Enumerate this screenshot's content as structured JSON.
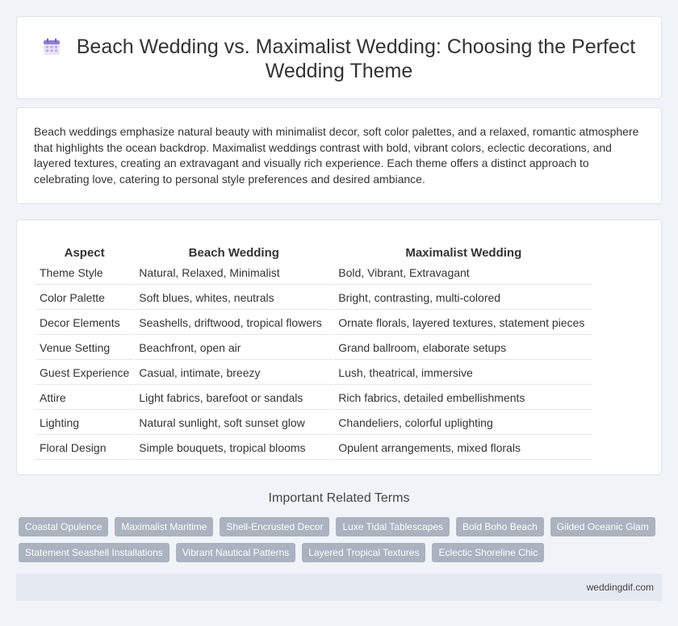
{
  "header": {
    "title": "Beach Wedding vs. Maximalist Wedding: Choosing the Perfect Wedding Theme",
    "icon": "calendar-icon"
  },
  "intro": {
    "text": "Beach weddings emphasize natural beauty with minimalist decor, soft color palettes, and a relaxed, romantic atmosphere that highlights the ocean backdrop. Maximalist weddings contrast with bold, vibrant colors, eclectic decorations, and layered textures, creating an extravagant and visually rich experience. Each theme offers a distinct approach to celebrating love, catering to personal style preferences and desired ambiance."
  },
  "table": {
    "headers": [
      "Aspect",
      "Beach Wedding",
      "Maximalist Wedding"
    ],
    "rows": [
      [
        "Theme Style",
        "Natural, Relaxed, Minimalist",
        "Bold, Vibrant, Extravagant"
      ],
      [
        "Color Palette",
        "Soft blues, whites, neutrals",
        "Bright, contrasting, multi-colored"
      ],
      [
        "Decor Elements",
        "Seashells, driftwood, tropical flowers",
        "Ornate florals, layered textures, statement pieces"
      ],
      [
        "Venue Setting",
        "Beachfront, open air",
        "Grand ballroom, elaborate setups"
      ],
      [
        "Guest Experience",
        "Casual, intimate, breezy",
        "Lush, theatrical, immersive"
      ],
      [
        "Attire",
        "Light fabrics, barefoot or sandals",
        "Rich fabrics, detailed embellishments"
      ],
      [
        "Lighting",
        "Natural sunlight, soft sunset glow",
        "Chandeliers, colorful uplighting"
      ],
      [
        "Floral Design",
        "Simple bouquets, tropical blooms",
        "Opulent arrangements, mixed florals"
      ]
    ]
  },
  "related": {
    "heading": "Important Related Terms",
    "tags_row1": [
      "Coastal Opulence",
      "Maximalist Maritime",
      "Shell-Encrusted Decor",
      "Luxe Tidal Tablescapes",
      "Bold Boho Beach",
      "Gilded Oceanic Glam"
    ],
    "tags_row2": [
      "Statement Seashell Installations",
      "Vibrant Nautical Patterns",
      "Layered Tropical Textures",
      "Eclectic Shoreline Chic"
    ]
  },
  "footer": {
    "site": "weddingdif.com"
  },
  "colors": {
    "background": "#f0f3f8",
    "tag": "#aab3bf",
    "footer": "#e4e9f2"
  }
}
